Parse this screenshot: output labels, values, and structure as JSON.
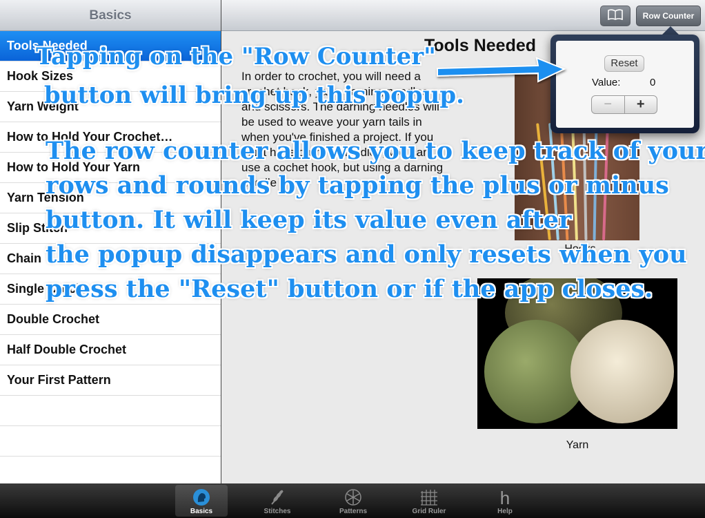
{
  "sidebar": {
    "title": "Basics",
    "items": [
      {
        "label": "Tools Needed"
      },
      {
        "label": "Hook Sizes"
      },
      {
        "label": "Yarn Weight"
      },
      {
        "label": "How to Hold Your Crochet…"
      },
      {
        "label": "How to Hold Your Yarn"
      },
      {
        "label": "Yarn Tension"
      },
      {
        "label": "Slip Stitch"
      },
      {
        "label": "Chain"
      },
      {
        "label": "Single Crochet"
      },
      {
        "label": "Double Crochet"
      },
      {
        "label": "Half Double Crochet"
      },
      {
        "label": "Your First Pattern"
      }
    ]
  },
  "header": {
    "book_icon": "book-icon",
    "row_counter_label": "Row Counter"
  },
  "content": {
    "title": "Tools Needed",
    "body": "In order to crochet, you will need a crochet hook, yarn, darning needles, and scissors. The darning needles will be used to weave your yarn tails in when you've finished a project. If you don't have darning needles, you can use a cochet hook, but using a darning needle",
    "needles_caption": "Hooks",
    "yarn_caption": "Yarn"
  },
  "popover": {
    "reset_label": "Reset",
    "value_label": "Value:",
    "value": "0",
    "minus_label": "−",
    "plus_label": "+"
  },
  "annotations": {
    "callout_1": "Tapping on the \"Row Counter\"\n button will bring up this popup.",
    "callout_2": "The row counter allows you to keep track of your\nrows and rounds by tapping the plus or minus\nbutton. It will keep its value even after\nthe popup disappears and only resets when you\npress the \"Reset\" button or if the app closes."
  },
  "tabbar": {
    "tabs": [
      {
        "label": "Basics",
        "icon": "head-icon"
      },
      {
        "label": "Stitches",
        "icon": "wheat-icon"
      },
      {
        "label": "Patterns",
        "icon": "snowflake-icon"
      },
      {
        "label": "Grid Ruler",
        "icon": "grid-icon"
      },
      {
        "label": "Help",
        "icon": "help-icon"
      }
    ]
  },
  "colors": {
    "selection_blue": "#0a63d8",
    "annotation_blue": "#1e8ff0",
    "tabbar_dark": "#0c0c0c"
  }
}
